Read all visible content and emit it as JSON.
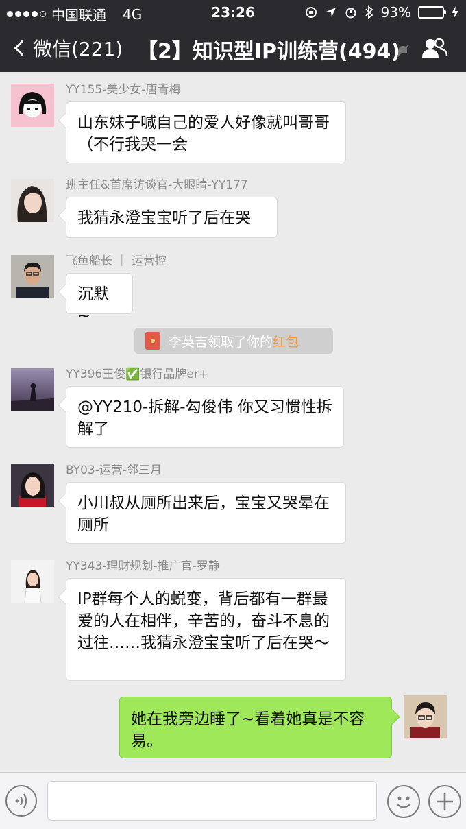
{
  "status_bar": {
    "carrier": "中国联通",
    "network": "4G",
    "time": "23:26",
    "battery": "93%",
    "battery_level": 0.93
  },
  "nav": {
    "back_label": "微信(221)",
    "title": "【2】知识型IP训练营(494)",
    "icons": [
      "back-chevron-icon",
      "mute-icon",
      "group-members-icon"
    ]
  },
  "messages": [
    {
      "sender": "YY155-美少女-唐青梅",
      "text": "山东妹子喊自己的爱人好像就叫哥哥（不行我哭一会"
    },
    {
      "sender": "班主任&首席访谈官-大眼睛-YY177",
      "text": "我猜永澄宝宝听了后在哭"
    },
    {
      "sender": "飞鱼船长 ｜ 运营控",
      "text": "沉默~"
    },
    {
      "sender": "YY396王俊✅银行品牌er+",
      "text": "@YY210-拆解-勾俊伟 你又习惯性拆解了"
    },
    {
      "sender": "BY03-运营-邻三月",
      "text": "小川叔从厕所出来后，宝宝又哭晕在厕所"
    },
    {
      "sender": "YY343-理财规划-推广官-罗静",
      "text": "IP群每个人的蜕变，背后都有一群最爱的人在相伴，辛苦的，奋斗不息的过往……我猜永澄宝宝听了后在哭～"
    }
  ],
  "system_notice": {
    "prefix": "李英吉领取了你的",
    "highlight": "红包"
  },
  "my_message": {
    "text": "她在我旁边睡了~看着她真是不容易。"
  },
  "input_bar": {
    "icons": [
      "voice-icon",
      "emoji-icon",
      "plus-icon"
    ]
  },
  "colors": {
    "topbar": "#2b2b2f",
    "background": "#ebebeb",
    "my_bubble": "#9fe85a",
    "red_packet_highlight": "#f29c38"
  }
}
